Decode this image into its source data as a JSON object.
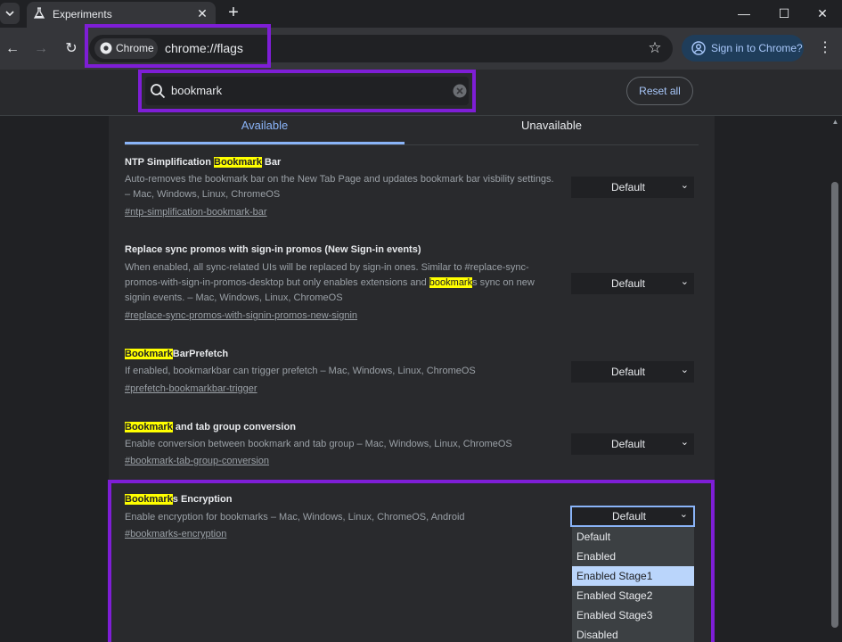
{
  "tab": {
    "title": "Experiments",
    "close": "✕"
  },
  "window": {
    "new_tab": "+",
    "minimize": "—",
    "maximize": "☐",
    "close": "✕"
  },
  "toolbar": {
    "back": "←",
    "forward": "→",
    "reload": "↻",
    "chip_label": "Chrome",
    "url": "chrome://flags",
    "star": "☆",
    "signin_label": "Sign in to Chrome?",
    "more": "⋮"
  },
  "header": {
    "search_value": "bookmark",
    "reset_label": "Reset all"
  },
  "tabs": {
    "available": "Available",
    "unavailable": "Unavailable"
  },
  "flags": [
    {
      "name_pre": "NTP Simplification ",
      "name_hl": "Bookmark",
      "name_post": " Bar",
      "desc": "Auto-removes the bookmark bar on the New Tab Page and updates bookmark bar visbility settings. – Mac, Windows, Linux, ChromeOS",
      "link": "#ntp-simplification-bookmark-bar",
      "value": "Default"
    },
    {
      "name": "Replace sync promos with sign-in promos (New Sign-in events)",
      "desc_pre": "When enabled, all sync-related UIs will be replaced by sign-in ones. Similar to #replace-sync-promos-with-sign-in-promos-desktop but only enables extensions and ",
      "desc_hl": "bookmark",
      "desc_post": "s sync on new signin events. – Mac, Windows, Linux, ChromeOS",
      "link": "#replace-sync-promos-with-signin-promos-new-signin",
      "value": "Default"
    },
    {
      "name_hl": "Bookmark",
      "name_post": "BarPrefetch",
      "desc": "If enabled, bookmarkbar can trigger prefetch – Mac, Windows, Linux, ChromeOS",
      "link": "#prefetch-bookmarkbar-trigger",
      "value": "Default"
    },
    {
      "name_hl": "Bookmark",
      "name_post": " and tab group conversion",
      "desc": "Enable conversion between bookmark and tab group – Mac, Windows, Linux, ChromeOS",
      "link": "#bookmark-tab-group-conversion",
      "value": "Default"
    },
    {
      "name_hl": "Bookmark",
      "name_post": "s Encryption",
      "desc": "Enable encryption for bookmarks – Mac, Windows, Linux, ChromeOS, Android",
      "link": "#bookmarks-encryption",
      "value": "Default"
    }
  ],
  "dropdown": {
    "options": [
      "Default",
      "Enabled",
      "Enabled Stage1",
      "Enabled Stage2",
      "Enabled Stage3",
      "Disabled"
    ],
    "highlighted": "Enabled Stage1"
  },
  "colors": {
    "accent": "#8ab4f8",
    "highlight": "#ffff00",
    "annotation": "#7e1ed6"
  }
}
